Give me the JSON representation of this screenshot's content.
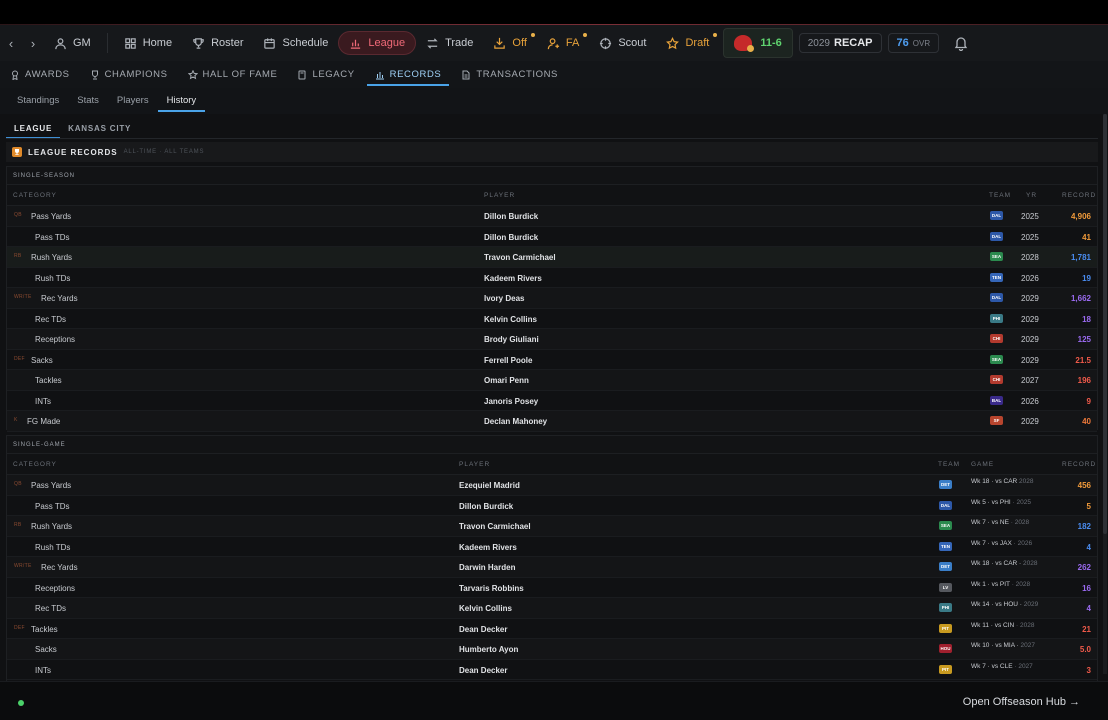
{
  "nav": {
    "back": "‹",
    "forward": "›",
    "items": [
      {
        "label": "GM",
        "icon": "user-icon"
      },
      {
        "label": "Home",
        "icon": "home-icon"
      },
      {
        "label": "Roster",
        "icon": "trophy-icon"
      },
      {
        "label": "Schedule",
        "icon": "calendar-icon"
      },
      {
        "label": "League",
        "icon": "chart-icon",
        "active": true
      },
      {
        "label": "Trade",
        "icon": "swap-icon"
      },
      {
        "label": "Off",
        "icon": "inbox-icon",
        "dot": true
      },
      {
        "label": "FA",
        "icon": "user-plus-icon",
        "dot": true
      },
      {
        "label": "Scout",
        "icon": "crosshair-icon"
      },
      {
        "label": "Draft",
        "icon": "star-icon",
        "dot": true
      }
    ],
    "team_record": "11-6",
    "season_year": "2029",
    "season_label": "RECAP",
    "ovr_value": "76",
    "ovr_label": "OVR"
  },
  "subnav": {
    "items": [
      {
        "label": "AWARDS",
        "icon": "award-icon"
      },
      {
        "label": "CHAMPIONS",
        "icon": "cup-icon"
      },
      {
        "label": "HALL OF FAME",
        "icon": "star-icon"
      },
      {
        "label": "LEGACY",
        "icon": "book-icon"
      },
      {
        "label": "RECORDS",
        "icon": "bar-chart-icon",
        "active": true
      },
      {
        "label": "TRANSACTIONS",
        "icon": "doc-icon"
      }
    ]
  },
  "tabs": [
    "Standings",
    "Stats",
    "Players",
    "History"
  ],
  "active_tab": "History",
  "scope_tabs": [
    "LEAGUE",
    "KANSAS CITY"
  ],
  "records_header": {
    "title": "LEAGUE RECORDS",
    "subtitle": "ALL-TIME · ALL TEAMS"
  },
  "single_season": {
    "title": "SINGLE-SEASON",
    "columns": {
      "category": "CATEGORY",
      "player": "PLAYER",
      "team": "TEAM",
      "year": "YR",
      "record": "RECORD"
    },
    "rows": [
      {
        "pos": "QB",
        "category": "Pass Yards",
        "player": "Dillon Burdick",
        "team": "DAL",
        "year": "2025",
        "record": "4,906"
      },
      {
        "pos": "",
        "category": "Pass TDs",
        "player": "Dillon Burdick",
        "team": "DAL",
        "year": "2025",
        "record": "41"
      },
      {
        "pos": "RB",
        "category": "Rush Yards",
        "player": "Travon Carmichael",
        "team": "SEA",
        "year": "2028",
        "record": "1,781"
      },
      {
        "pos": "",
        "category": "Rush TDs",
        "player": "Kadeem Rivers",
        "team": "TEN",
        "year": "2026",
        "record": "19"
      },
      {
        "pos": "WR/TE",
        "category": "Rec Yards",
        "player": "Ivory Deas",
        "team": "DAL",
        "year": "2029",
        "record": "1,662"
      },
      {
        "pos": "",
        "category": "Rec TDs",
        "player": "Kelvin Collins",
        "team": "PHI",
        "year": "2029",
        "record": "18"
      },
      {
        "pos": "",
        "category": "Receptions",
        "player": "Brody Giuliani",
        "team": "CHI",
        "year": "2029",
        "record": "125"
      },
      {
        "pos": "DEF",
        "category": "Sacks",
        "player": "Ferrell Poole",
        "team": "SEA",
        "year": "2029",
        "record": "21.5"
      },
      {
        "pos": "",
        "category": "Tackles",
        "player": "Omari Penn",
        "team": "CHI",
        "year": "2027",
        "record": "196"
      },
      {
        "pos": "",
        "category": "INTs",
        "player": "Janoris Posey",
        "team": "BAL",
        "year": "2026",
        "record": "9"
      },
      {
        "pos": "K",
        "category": "FG Made",
        "player": "Declan Mahoney",
        "team": "SF",
        "year": "2029",
        "record": "40"
      }
    ]
  },
  "single_game": {
    "title": "SINGLE-GAME",
    "columns": {
      "category": "CATEGORY",
      "player": "PLAYER",
      "team": "TEAM",
      "game": "GAME",
      "record": "RECORD"
    },
    "rows": [
      {
        "pos": "QB",
        "category": "Pass Yards",
        "player": "Ezequiel Madrid",
        "team": "DET",
        "game": "Wk 18 · vs CAR",
        "game_year": "2028",
        "record": "456"
      },
      {
        "pos": "",
        "category": "Pass TDs",
        "player": "Dillon Burdick",
        "team": "DAL",
        "game": "Wk 5 · vs PHI",
        "game_year": "· 2025",
        "record": "5"
      },
      {
        "pos": "RB",
        "category": "Rush Yards",
        "player": "Travon Carmichael",
        "team": "SEA",
        "game": "Wk 7 · vs NE",
        "game_year": "· 2028",
        "record": "182"
      },
      {
        "pos": "",
        "category": "Rush TDs",
        "player": "Kadeem Rivers",
        "team": "TEN",
        "game": "Wk 7 · vs JAX",
        "game_year": "· 2026",
        "record": "4"
      },
      {
        "pos": "WR/TE",
        "category": "Rec Yards",
        "player": "Darwin Harden",
        "team": "DET",
        "game": "Wk 18 · vs CAR ·",
        "game_year": "2028",
        "record": "262"
      },
      {
        "pos": "",
        "category": "Receptions",
        "player": "Tarvaris Robbins",
        "team": "LV",
        "game": "Wk 1 · vs PIT",
        "game_year": "· 2028",
        "record": "16"
      },
      {
        "pos": "",
        "category": "Rec TDs",
        "player": "Kelvin Collins",
        "team": "PHI",
        "game": "Wk 14 · vs HOU ·",
        "game_year": "2029",
        "record": "4"
      },
      {
        "pos": "DEF",
        "category": "Tackles",
        "player": "Dean Decker",
        "team": "PIT",
        "game": "Wk 11 · vs CIN",
        "game_year": "· 2028",
        "record": "21"
      },
      {
        "pos": "",
        "category": "Sacks",
        "player": "Humberto Ayon",
        "team": "HOU",
        "game": "Wk 10 · vs MIA ·",
        "game_year": "2027",
        "record": "5.0"
      },
      {
        "pos": "",
        "category": "INTs",
        "player": "Dean Decker",
        "team": "PIT",
        "game": "Wk 7 · vs CLE",
        "game_year": "· 2027",
        "record": "3"
      }
    ]
  },
  "footer": {
    "hub_link": "Open Offseason Hub →"
  },
  "colors": {
    "accent_red": "#f06a78",
    "accent_blue": "#4aa3e8",
    "win_green": "#5fd36f",
    "passing": "#f09a3a",
    "rushing": "#4a8cf0",
    "receiving": "#9a6af0",
    "defense": "#f05a4a",
    "kicking": "#f07a3a"
  }
}
